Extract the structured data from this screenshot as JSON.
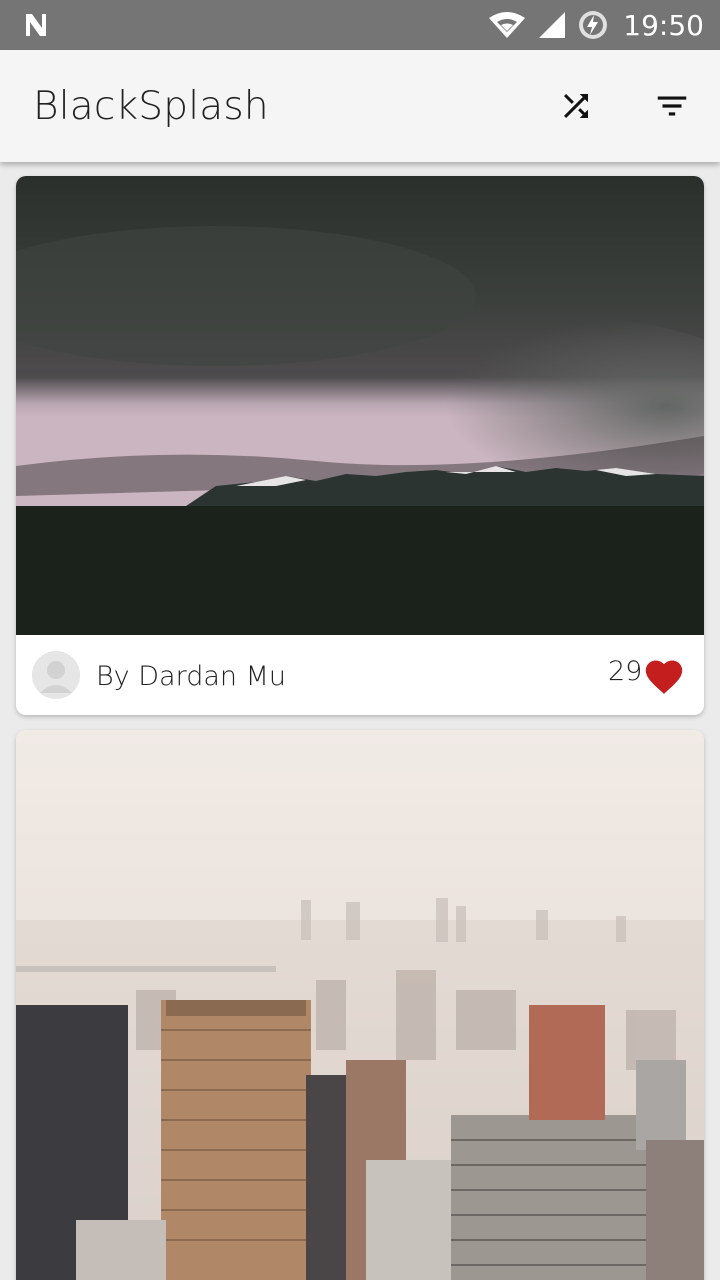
{
  "status_bar": {
    "time": "19:50",
    "icons": [
      "n-logo-icon",
      "wifi-icon",
      "signal-icon",
      "battery-charging-icon"
    ]
  },
  "app_bar": {
    "title": "BlackSplash",
    "actions": [
      {
        "icon": "shuffle-icon"
      },
      {
        "icon": "filter-list-icon"
      }
    ]
  },
  "feed": {
    "cards": [
      {
        "image": "dark storm clouds over snowy mountains",
        "author": "By Dardan Mu",
        "likes": "29",
        "like_icon": "heart-icon",
        "like_color": "#c41e1e"
      },
      {
        "image": "hazy city skyline with skyscrapers"
      }
    ]
  },
  "colors": {
    "status_bar": "#757575",
    "app_bar": "#f5f5f5",
    "background": "#ebebeb",
    "heart": "#c41e1e"
  }
}
